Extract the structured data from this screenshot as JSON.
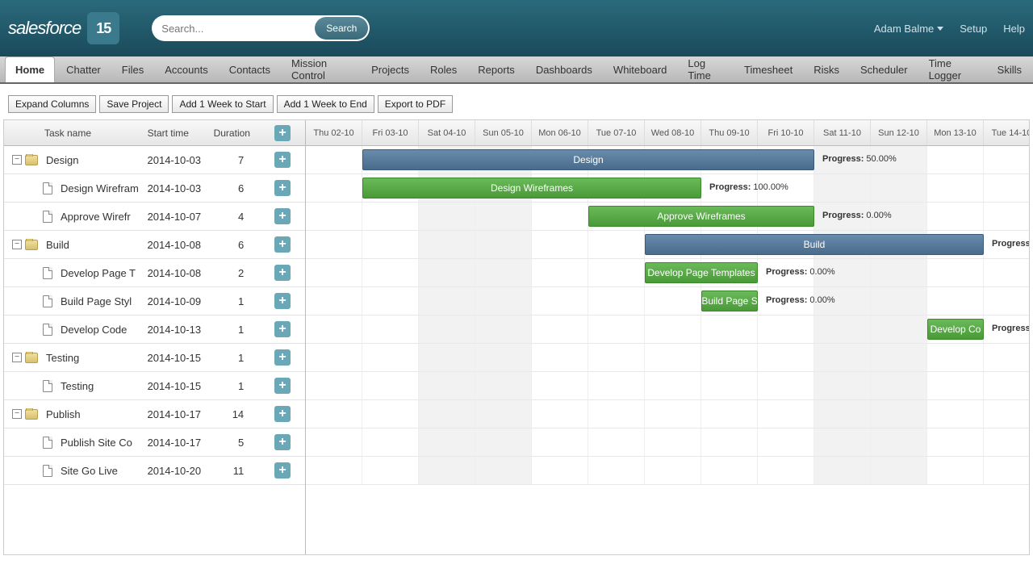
{
  "header": {
    "logo_text": "salesforce",
    "logo_badge": "15",
    "search_placeholder": "Search...",
    "search_button": "Search",
    "user_name": "Adam Balme",
    "setup": "Setup",
    "help": "Help"
  },
  "tabs": [
    {
      "label": "Home",
      "active": true
    },
    {
      "label": "Chatter"
    },
    {
      "label": "Files"
    },
    {
      "label": "Accounts"
    },
    {
      "label": "Contacts"
    },
    {
      "label": "Mission Control"
    },
    {
      "label": "Projects"
    },
    {
      "label": "Roles"
    },
    {
      "label": "Reports"
    },
    {
      "label": "Dashboards"
    },
    {
      "label": "Whiteboard"
    },
    {
      "label": "Log Time"
    },
    {
      "label": "Timesheet"
    },
    {
      "label": "Risks"
    },
    {
      "label": "Scheduler"
    },
    {
      "label": "Time Logger"
    },
    {
      "label": "Skills"
    }
  ],
  "toolbar": {
    "expand": "Expand Columns",
    "save": "Save Project",
    "add_start": "Add 1 Week to Start",
    "add_end": "Add 1 Week to End",
    "export": "Export to PDF"
  },
  "grid": {
    "col_name": "Task name",
    "col_start": "Start time",
    "col_dur": "Duration"
  },
  "days": [
    {
      "label": "Thu 02-10",
      "weekend": false
    },
    {
      "label": "Fri 03-10",
      "weekend": false
    },
    {
      "label": "Sat 04-10",
      "weekend": true
    },
    {
      "label": "Sun 05-10",
      "weekend": true
    },
    {
      "label": "Mon 06-10",
      "weekend": false
    },
    {
      "label": "Tue 07-10",
      "weekend": false
    },
    {
      "label": "Wed 08-10",
      "weekend": false
    },
    {
      "label": "Thu 09-10",
      "weekend": false
    },
    {
      "label": "Fri 10-10",
      "weekend": false
    },
    {
      "label": "Sat 11-10",
      "weekend": true
    },
    {
      "label": "Sun 12-10",
      "weekend": true
    },
    {
      "label": "Mon 13-10",
      "weekend": false
    },
    {
      "label": "Tue 14-10",
      "weekend": false
    }
  ],
  "tasks": [
    {
      "name": "Design",
      "start": "2014-10-03",
      "dur": "7",
      "lvl": 0,
      "type": "group",
      "bar_start": 1,
      "bar_len": 8,
      "bar_label": "Design",
      "progress": "50.00%"
    },
    {
      "name": "Design Wirefram",
      "start": "2014-10-03",
      "dur": "6",
      "lvl": 1,
      "type": "task",
      "bar_start": 1,
      "bar_len": 6,
      "bar_label": "Design Wireframes",
      "progress": "100.00%"
    },
    {
      "name": "Approve Wirefr",
      "start": "2014-10-07",
      "dur": "4",
      "lvl": 1,
      "type": "task",
      "bar_start": 5,
      "bar_len": 4,
      "bar_label": "Approve Wireframes",
      "progress": "0.00%"
    },
    {
      "name": "Build",
      "start": "2014-10-08",
      "dur": "6",
      "lvl": 0,
      "type": "group",
      "bar_start": 6,
      "bar_len": 6,
      "bar_label": "Build",
      "progress": ""
    },
    {
      "name": "Develop Page T",
      "start": "2014-10-08",
      "dur": "2",
      "lvl": 1,
      "type": "task",
      "bar_start": 6,
      "bar_len": 2,
      "bar_label": "Develop Page Templates",
      "progress": "0.00%"
    },
    {
      "name": "Build Page Styl",
      "start": "2014-10-09",
      "dur": "1",
      "lvl": 1,
      "type": "task",
      "bar_start": 7,
      "bar_len": 1,
      "bar_label": "Build Page S",
      "progress": "0.00%"
    },
    {
      "name": "Develop Code",
      "start": "2014-10-13",
      "dur": "1",
      "lvl": 1,
      "type": "task",
      "bar_start": 11,
      "bar_len": 1,
      "bar_label": "Develop Co",
      "progress": ""
    },
    {
      "name": "Testing",
      "start": "2014-10-15",
      "dur": "1",
      "lvl": 0,
      "type": "group"
    },
    {
      "name": "Testing",
      "start": "2014-10-15",
      "dur": "1",
      "lvl": 1,
      "type": "task"
    },
    {
      "name": "Publish",
      "start": "2014-10-17",
      "dur": "14",
      "lvl": 0,
      "type": "group"
    },
    {
      "name": "Publish Site Co",
      "start": "2014-10-17",
      "dur": "5",
      "lvl": 1,
      "type": "task"
    },
    {
      "name": "Site Go Live",
      "start": "2014-10-20",
      "dur": "11",
      "lvl": 1,
      "type": "task"
    }
  ],
  "progress_word": "Progress:",
  "progress_partial_right": "Progress:"
}
